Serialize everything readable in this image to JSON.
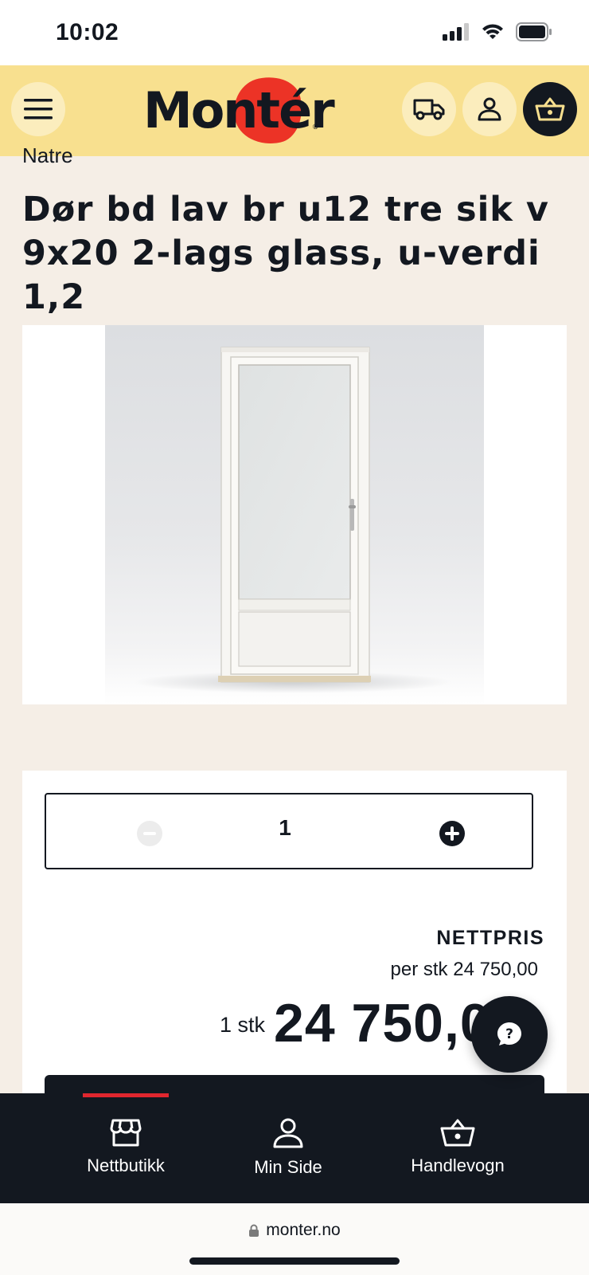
{
  "status_bar": {
    "time": "10:02"
  },
  "header": {
    "logo_text": "Montér",
    "logo_reg": "®",
    "icons": [
      "menu-icon",
      "truck-icon",
      "user-icon",
      "basket-icon"
    ]
  },
  "breadcrumb": "Natre",
  "product": {
    "title": "Dør bd lav br u12 tre sik v 9x20 2-lags glass, u-verdi 1,2"
  },
  "purchase": {
    "quantity": "1",
    "price_label": "NETTPRIS",
    "unit_price": "per stk 24 750,00",
    "total_qty": "1 stk",
    "total_price": "24 750,00"
  },
  "bottom_nav": {
    "items": [
      {
        "label": "Nettbutikk",
        "icon": "storefront-icon",
        "active": true
      },
      {
        "label": "Min Side",
        "icon": "person-icon",
        "active": false
      },
      {
        "label": "Handlevogn",
        "icon": "basket-icon",
        "active": false
      }
    ]
  },
  "browser": {
    "url": "monter.no"
  },
  "colors": {
    "header_bg": "#f8e08f",
    "page_bg": "#f5eee6",
    "dark": "#131820",
    "brand_red": "#ec3326",
    "active_red": "#e0262e"
  }
}
